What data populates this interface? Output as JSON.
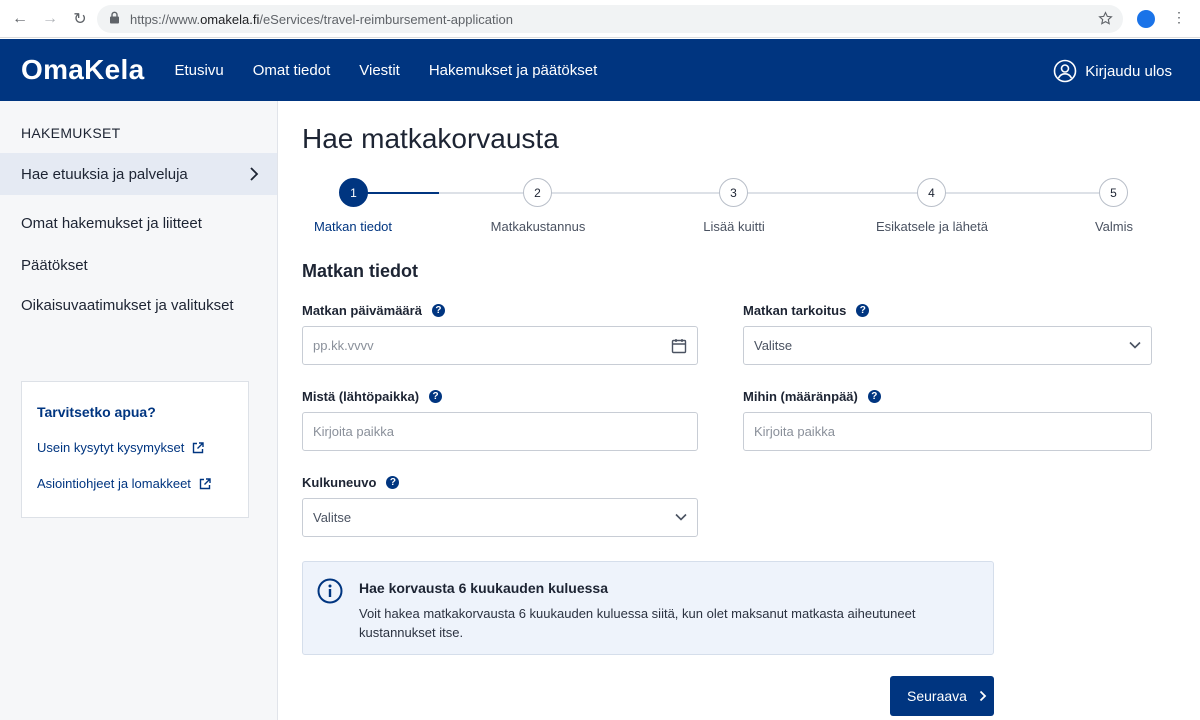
{
  "browser": {
    "url_prefix": "https://www.",
    "url_domain": "omakela.fi",
    "url_path": "/eServices/travel-reimbursement-application"
  },
  "header": {
    "logo": "OmaKela",
    "nav": [
      "Etusivu",
      "Omat tiedot",
      "Viestit",
      "Hakemukset ja päätökset"
    ],
    "logout_label": "Kirjaudu ulos"
  },
  "sidebar": {
    "heading": "HAKEMUKSET",
    "items": [
      {
        "label": "Hae etuuksia ja palveluja",
        "active": true
      },
      {
        "label": "Omat hakemukset ja liitteet"
      },
      {
        "label": "Päätökset"
      },
      {
        "label": "Oikaisuvaatimukset ja valitukset"
      }
    ],
    "help": {
      "title": "Tarvitsetko apua?",
      "links": [
        "Usein kysytyt kysymykset",
        "Asiointiohjeet ja lomakkeet"
      ]
    }
  },
  "main": {
    "title": "Hae matkakorvausta",
    "steps": [
      {
        "number": "1",
        "label": "Matkan tiedot",
        "active": true
      },
      {
        "number": "2",
        "label": "Matkakustannus"
      },
      {
        "number": "3",
        "label": "Lisää kuitti"
      },
      {
        "number": "4",
        "label": "Esikatsele ja lähetä"
      },
      {
        "number": "5",
        "label": "Valmis"
      }
    ],
    "section_title": "Matkan tiedot",
    "fields": {
      "date": {
        "label": "Matkan päivämäärä",
        "placeholder": "pp.kk.vvvv"
      },
      "purpose": {
        "label": "Matkan tarkoitus",
        "value": "Valitse"
      },
      "from": {
        "label": "Mistä (lähtöpaikka)",
        "placeholder": "Kirjoita paikka"
      },
      "to": {
        "label": "Mihin (määränpää)",
        "placeholder": "Kirjoita paikka"
      },
      "vehicle": {
        "label": "Kulkuneuvo",
        "value": "Valitse"
      }
    },
    "info": {
      "title": "Hae korvausta 6 kuukauden kuluessa",
      "text": "Voit hakea matkakorvausta 6 kuukauden kuluessa siitä, kun olet maksanut matkasta aiheutuneet kustannukset itse."
    },
    "next_label": "Seuraava"
  },
  "colors": {
    "brand": "#003580",
    "info_bg": "#eef3fb"
  }
}
